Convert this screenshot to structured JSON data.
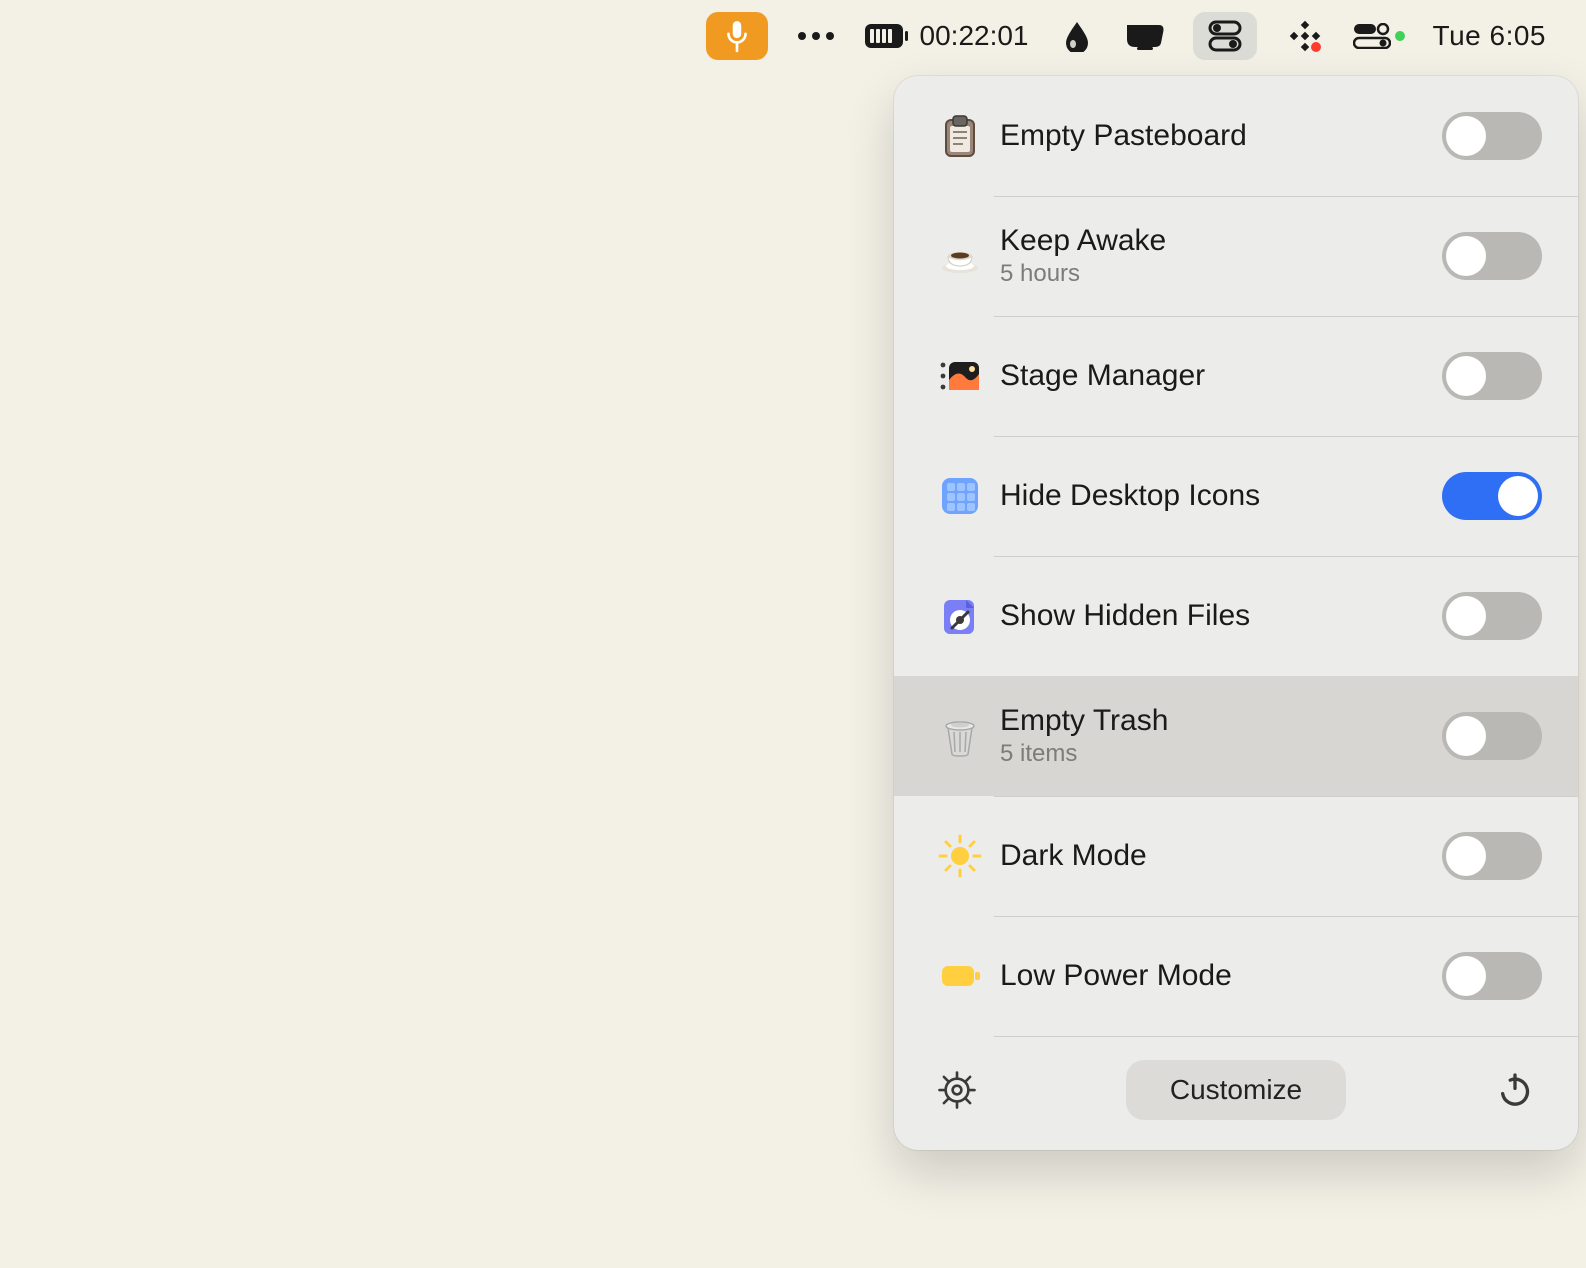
{
  "menubar": {
    "timer": "00:22:01",
    "clock": "Tue 6:05"
  },
  "panel": {
    "rows": [
      {
        "title": "Empty Pasteboard",
        "sub": "",
        "on": false,
        "hover": false,
        "icon": "clipboard"
      },
      {
        "title": "Keep Awake",
        "sub": "5 hours",
        "on": false,
        "hover": false,
        "icon": "coffee"
      },
      {
        "title": "Stage Manager",
        "sub": "",
        "on": false,
        "hover": false,
        "icon": "stage"
      },
      {
        "title": "Hide Desktop Icons",
        "sub": "",
        "on": true,
        "hover": false,
        "icon": "desktop"
      },
      {
        "title": "Show Hidden Files",
        "sub": "",
        "on": false,
        "hover": false,
        "icon": "files"
      },
      {
        "title": "Empty Trash",
        "sub": "5 items",
        "on": false,
        "hover": true,
        "icon": "trash"
      },
      {
        "title": "Dark Mode",
        "sub": "",
        "on": false,
        "hover": false,
        "icon": "sun"
      },
      {
        "title": "Low Power Mode",
        "sub": "",
        "on": false,
        "hover": false,
        "icon": "battery"
      }
    ],
    "footer": {
      "customize": "Customize"
    }
  }
}
